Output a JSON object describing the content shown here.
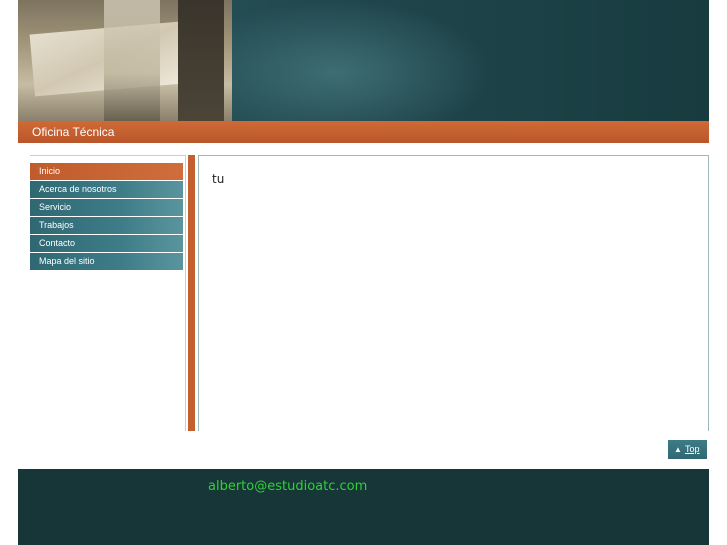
{
  "header": {
    "site_title": "Oficina Técnica"
  },
  "sidebar": {
    "items": [
      {
        "label": "Inicio",
        "active": true
      },
      {
        "label": "Acerca de nosotros",
        "active": false
      },
      {
        "label": "Servicio",
        "active": false
      },
      {
        "label": "Trabajos",
        "active": false
      },
      {
        "label": "Contacto",
        "active": false
      },
      {
        "label": "Mapa del sitio",
        "active": false
      }
    ]
  },
  "main": {
    "content_text": "tu"
  },
  "back_to_top": {
    "label": "Top",
    "icon": "chevron-up-icon"
  },
  "footer": {
    "email": "alberto@estudioatc.com"
  },
  "colors": {
    "accent_orange": "#c2612f",
    "nav_teal": "#2f6873",
    "footer_bg": "#173638",
    "email_green": "#2fd135"
  }
}
